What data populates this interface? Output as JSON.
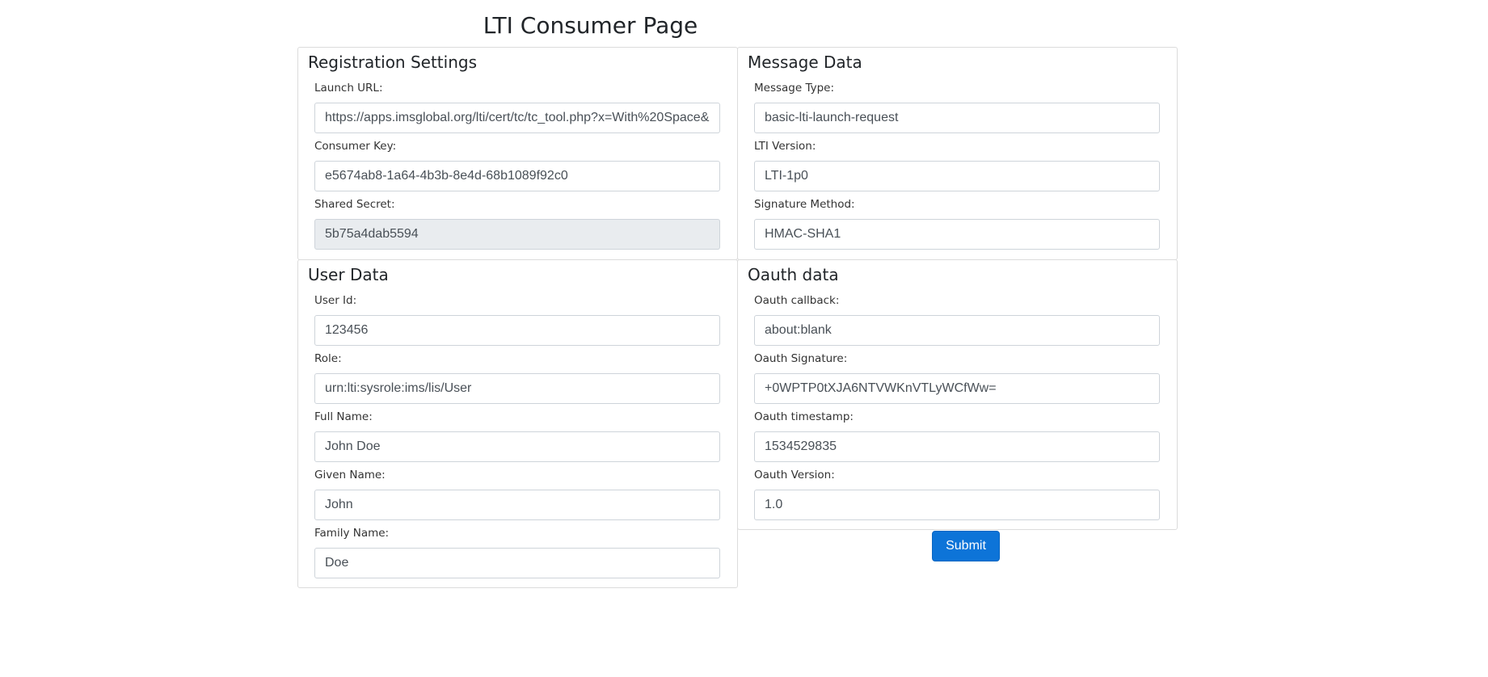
{
  "page": {
    "title": "LTI Consumer Page"
  },
  "registration": {
    "title": "Registration Settings",
    "fields": [
      {
        "label": "Launch URL:",
        "value": "https://apps.imsglobal.org/lti/cert/tc/tc_tool.php?x=With%20Space&"
      },
      {
        "label": "Consumer Key:",
        "value": "e5674ab8-1a64-4b3b-8e4d-68b1089f92c0"
      },
      {
        "label": "Shared Secret:",
        "value": "5b75a4dab5594"
      }
    ]
  },
  "message": {
    "title": "Message Data",
    "fields": [
      {
        "label": "Message Type:",
        "value": "basic-lti-launch-request"
      },
      {
        "label": "LTI Version:",
        "value": "LTI-1p0"
      },
      {
        "label": "Signature Method:",
        "value": "HMAC-SHA1"
      }
    ]
  },
  "user": {
    "title": "User Data",
    "fields": [
      {
        "label": "User Id:",
        "value": "123456"
      },
      {
        "label": "Role:",
        "value": "urn:lti:sysrole:ims/lis/User"
      },
      {
        "label": "Full Name:",
        "value": "John Doe"
      },
      {
        "label": "Given Name:",
        "value": "John"
      },
      {
        "label": "Family Name:",
        "value": "Doe"
      }
    ]
  },
  "oauth": {
    "title": "Oauth data",
    "fields": [
      {
        "label": "Oauth callback:",
        "value": "about:blank"
      },
      {
        "label": "Oauth Signature:",
        "value": "+0WPTP0tXJA6NTVWKnVTLyWCfWw="
      },
      {
        "label": "Oauth timestamp:",
        "value": "1534529835"
      },
      {
        "label": "Oauth Version:",
        "value": "1.0"
      }
    ]
  },
  "actions": {
    "submit_label": "Submit"
  }
}
